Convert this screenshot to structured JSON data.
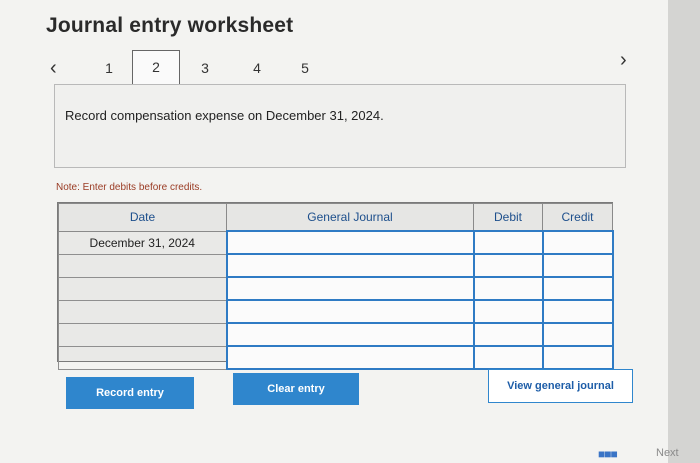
{
  "worksheet": {
    "title": "Journal entry worksheet",
    "prev_icon": "‹",
    "next_icon": "›",
    "steps": [
      "1",
      "2",
      "3",
      "4",
      "5"
    ],
    "active_step": "2"
  },
  "instruction": "Record compensation expense on December 31, 2024.",
  "note": "Note: Enter debits before credits.",
  "journal": {
    "headers": [
      "Date",
      "General Journal",
      "Debit",
      "Credit"
    ],
    "rows": [
      [
        "December 31, 2024",
        "",
        "",
        ""
      ],
      [
        "",
        "",
        "",
        ""
      ],
      [
        "",
        "",
        "",
        ""
      ],
      [
        "",
        "",
        "",
        ""
      ],
      [
        "",
        "",
        "",
        ""
      ],
      [
        "",
        "",
        "",
        ""
      ]
    ]
  },
  "buttons": {
    "record_entry": "Record entry",
    "clear_entry": "Clear entry",
    "view_general_journal": "View general journal"
  },
  "footer": {
    "grid_icon": "grid-icon",
    "next_label": "Next"
  },
  "colors": {
    "accent": "#2f86cd",
    "header_text": "#1d4f8c",
    "note_text": "#9a3b24"
  }
}
